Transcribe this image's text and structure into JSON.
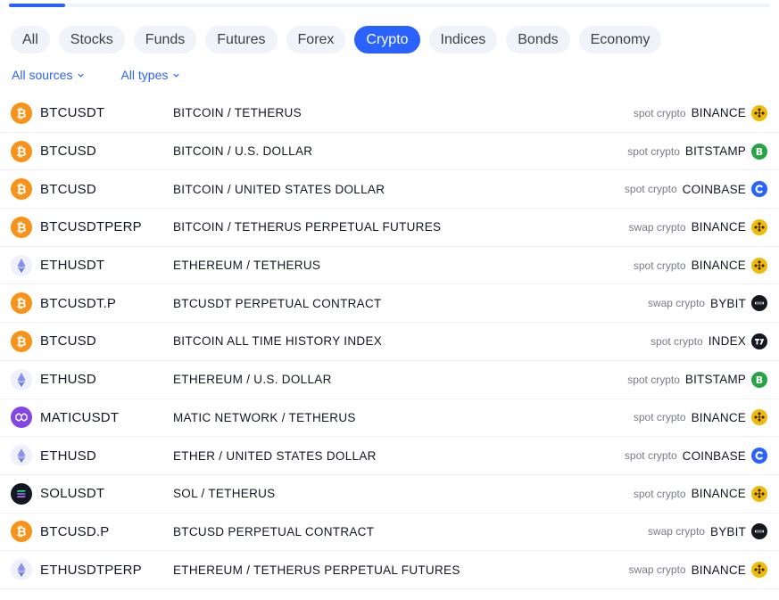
{
  "filters": [
    {
      "label": "All",
      "active": false
    },
    {
      "label": "Stocks",
      "active": false
    },
    {
      "label": "Funds",
      "active": false
    },
    {
      "label": "Futures",
      "active": false
    },
    {
      "label": "Forex",
      "active": false
    },
    {
      "label": "Crypto",
      "active": true
    },
    {
      "label": "Indices",
      "active": false
    },
    {
      "label": "Bonds",
      "active": false
    },
    {
      "label": "Economy",
      "active": false
    }
  ],
  "subfilters": {
    "sources": "All sources",
    "types": "All types"
  },
  "colors": {
    "accent": "#2962ff",
    "bitcoin": "#f7931a",
    "binance": "#f0b90b",
    "bitstamp": "#27a446",
    "coinbase": "#2962ff"
  },
  "rows": [
    {
      "symbol": "BTCUSDT",
      "description": "BITCOIN / TETHERUS",
      "type": "spot crypto",
      "exchange": "BINANCE",
      "coin": "bitcoin",
      "ex": "binance"
    },
    {
      "symbol": "BTCUSD",
      "description": "BITCOIN / U.S. DOLLAR",
      "type": "spot crypto",
      "exchange": "BITSTAMP",
      "coin": "bitcoin",
      "ex": "bitstamp"
    },
    {
      "symbol": "BTCUSD",
      "description": "BITCOIN / UNITED STATES DOLLAR",
      "type": "spot crypto",
      "exchange": "COINBASE",
      "coin": "bitcoin",
      "ex": "coinbase"
    },
    {
      "symbol": "BTCUSDTPERP",
      "description": "BITCOIN / TETHERUS PERPETUAL FUTURES",
      "type": "swap crypto",
      "exchange": "BINANCE",
      "coin": "bitcoin",
      "ex": "binance"
    },
    {
      "symbol": "ETHUSDT",
      "description": "ETHEREUM / TETHERUS",
      "type": "spot crypto",
      "exchange": "BINANCE",
      "coin": "ethereum",
      "ex": "binance"
    },
    {
      "symbol": "BTCUSDT.P",
      "description": "BTCUSDT PERPETUAL CONTRACT",
      "type": "swap crypto",
      "exchange": "BYBIT",
      "coin": "bitcoin",
      "ex": "bybit"
    },
    {
      "symbol": "BTCUSD",
      "description": "BITCOIN ALL TIME HISTORY INDEX",
      "type": "spot crypto",
      "exchange": "INDEX",
      "coin": "bitcoin",
      "ex": "index"
    },
    {
      "symbol": "ETHUSD",
      "description": "ETHEREUM / U.S. DOLLAR",
      "type": "spot crypto",
      "exchange": "BITSTAMP",
      "coin": "ethereum",
      "ex": "bitstamp"
    },
    {
      "symbol": "MATICUSDT",
      "description": "MATIC NETWORK / TETHERUS",
      "type": "spot crypto",
      "exchange": "BINANCE",
      "coin": "matic",
      "ex": "binance"
    },
    {
      "symbol": "ETHUSD",
      "description": "ETHER / UNITED STATES DOLLAR",
      "type": "spot crypto",
      "exchange": "COINBASE",
      "coin": "ethereum",
      "ex": "coinbase"
    },
    {
      "symbol": "SOLUSDT",
      "description": "SOL / TETHERUS",
      "type": "spot crypto",
      "exchange": "BINANCE",
      "coin": "solana",
      "ex": "binance"
    },
    {
      "symbol": "BTCUSD.P",
      "description": "BTCUSD PERPETUAL CONTRACT",
      "type": "swap crypto",
      "exchange": "BYBIT",
      "coin": "bitcoin",
      "ex": "bybit"
    },
    {
      "symbol": "ETHUSDTPERP",
      "description": "ETHEREUM / TETHERUS PERPETUAL FUTURES",
      "type": "swap crypto",
      "exchange": "BINANCE",
      "coin": "ethereum",
      "ex": "binance"
    }
  ]
}
